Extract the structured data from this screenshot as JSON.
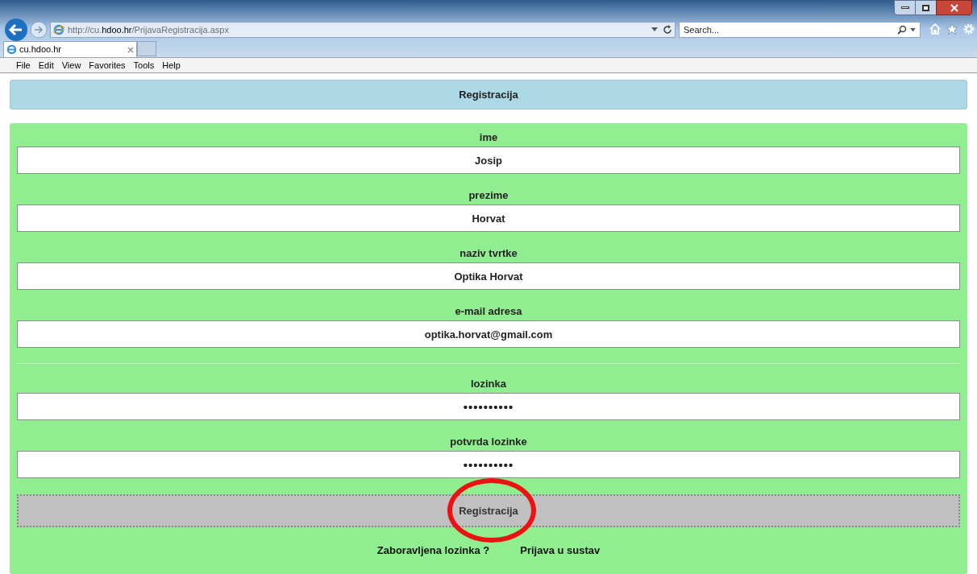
{
  "browser": {
    "address": {
      "prefix": "http://cu.",
      "domain": "hdoo.hr",
      "path": "/PrijavaRegistracija.aspx"
    },
    "search": {
      "placeholder": "Search..."
    },
    "tabs": [
      {
        "label": "cu.hdoo.hr",
        "selected": true
      }
    ],
    "menu": [
      "File",
      "Edit",
      "View",
      "Favorites",
      "Tools",
      "Help"
    ]
  },
  "header": {
    "title": "Registracija"
  },
  "form": {
    "fields": [
      {
        "label": "ime",
        "value": "Josip",
        "kind": "text",
        "divider_before": false
      },
      {
        "label": "prezime",
        "value": "Horvat",
        "kind": "text",
        "divider_before": false
      },
      {
        "label": "naziv tvrtke",
        "value": "Optika Horvat",
        "kind": "text",
        "divider_before": false
      },
      {
        "label": "e-mail adresa",
        "value": "optika.horvat@gmail.com",
        "kind": "text",
        "divider_before": false
      },
      {
        "label": "lozinka",
        "value": "••••••••••",
        "kind": "password",
        "divider_before": true
      },
      {
        "label": "potvrda lozinke",
        "value": "••••••••••",
        "kind": "password",
        "divider_before": false
      }
    ],
    "submit": {
      "label": "Registracija",
      "highlighted": true
    },
    "links": [
      "Zaboravljena lozinka ?",
      "Prijava u sustav"
    ]
  }
}
